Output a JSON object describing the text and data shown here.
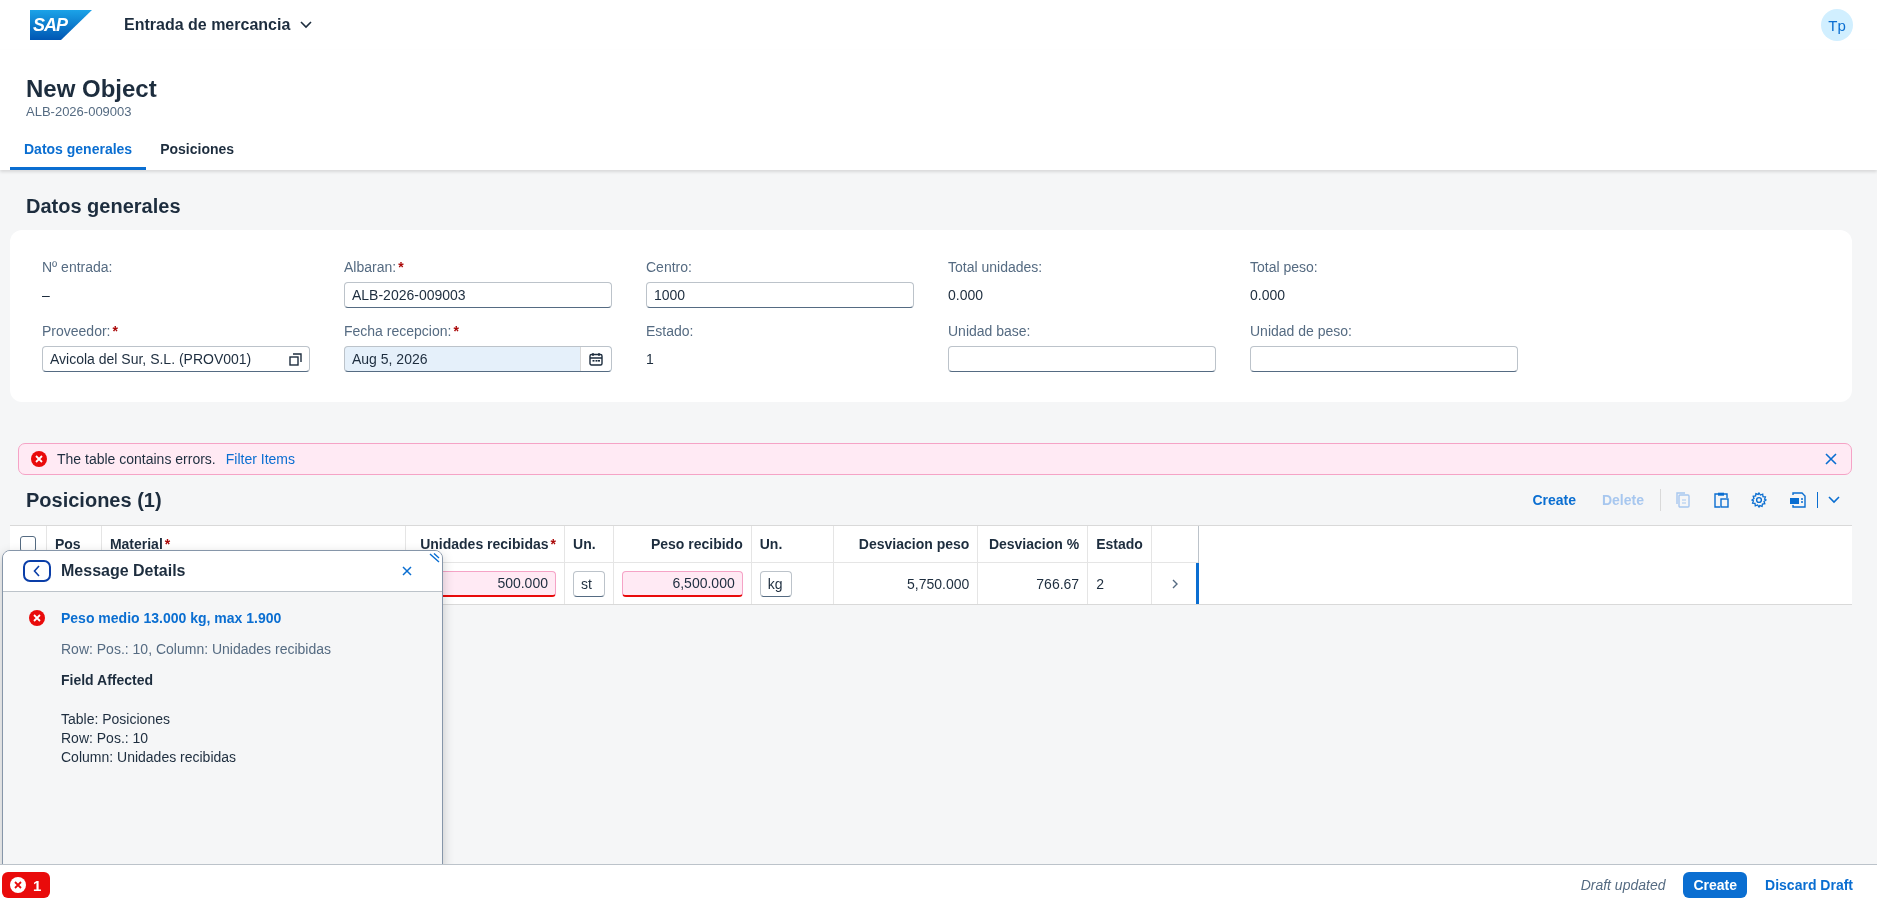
{
  "shell": {
    "logo": "SAP",
    "title": "Entrada de mercancia",
    "avatar": "Tp"
  },
  "header": {
    "title": "New Object",
    "subtitle": "ALB-2026-009003"
  },
  "tabs": [
    {
      "label": "Datos generales",
      "selected": true
    },
    {
      "label": "Posiciones",
      "selected": false
    }
  ],
  "general": {
    "title": "Datos generales",
    "fields": [
      {
        "label": "Nº entrada:",
        "kind": "text",
        "value": "–"
      },
      {
        "label": "Albaran:",
        "required_mark": "*",
        "kind": "input",
        "value": "ALB-2026-009003"
      },
      {
        "label": "Centro:",
        "kind": "input",
        "value": "1000"
      },
      {
        "label": "Total unidades:",
        "kind": "text",
        "value": "0.000"
      },
      {
        "label": "Total peso:",
        "kind": "text",
        "value": "0.000"
      },
      {
        "label": "Proveedor:",
        "required_mark": "*",
        "kind": "value_help",
        "value": "Avicola del Sur, S.L. (PROV001)"
      },
      {
        "label": "Fecha recepcion:",
        "required_mark": "*",
        "kind": "date",
        "value": "Aug 5, 2026"
      },
      {
        "label": "Estado:",
        "kind": "text",
        "value": "1"
      },
      {
        "label": "Unidad base:",
        "kind": "input"
      },
      {
        "label": "Unidad de peso:",
        "kind": "input"
      }
    ]
  },
  "message_strip": {
    "text": "The table contains errors.",
    "link": "Filter Items"
  },
  "positions": {
    "title": "Posiciones (1)",
    "actions": [
      {
        "label": "Create",
        "disabled": false
      },
      {
        "label": "Delete",
        "disabled": true
      }
    ],
    "select_all": {
      "checked": false
    },
    "columns": [
      {
        "label": "Pos"
      },
      {
        "label": "Material",
        "required_mark": "*"
      },
      {
        "label": "Unidades recibidas",
        "required_mark": "*"
      },
      {
        "label": "Un."
      },
      {
        "label": "Peso recibido"
      },
      {
        "label": "Un."
      },
      {
        "label": "Desviacion peso"
      },
      {
        "label": "Desviacion %"
      },
      {
        "label": "Estado"
      }
    ],
    "rows": [
      {
        "navigated": true,
        "cells": [
          {
            "kind": "covered"
          },
          {
            "kind": "covered"
          },
          {
            "kind": "input",
            "value": "500.000",
            "error": true
          },
          {
            "kind": "input",
            "value": "st",
            "error": false
          },
          {
            "kind": "input",
            "value": "6,500.000",
            "error": true
          },
          {
            "kind": "input",
            "value": "kg",
            "error": false
          },
          {
            "kind": "text",
            "value": "5,750.000"
          },
          {
            "kind": "text",
            "value": "766.67"
          },
          {
            "kind": "text",
            "value": "2"
          }
        ]
      }
    ]
  },
  "popover": {
    "title": "Message Details",
    "message": {
      "title": "Peso medio 13.000 kg, max 1.900",
      "subtitle": "Row: Pos.: 10, Column: Unidades recibidas"
    },
    "section_title": "Field Affected",
    "details": [
      "Table: Posiciones",
      "Row: Pos.: 10",
      "Column: Unidades recibidas"
    ]
  },
  "footer": {
    "error_count": "1",
    "status": "Draft updated",
    "actions": [
      {
        "label": "Create",
        "kind": "primary"
      },
      {
        "label": "Discard Draft",
        "kind": "transparent"
      }
    ]
  }
}
